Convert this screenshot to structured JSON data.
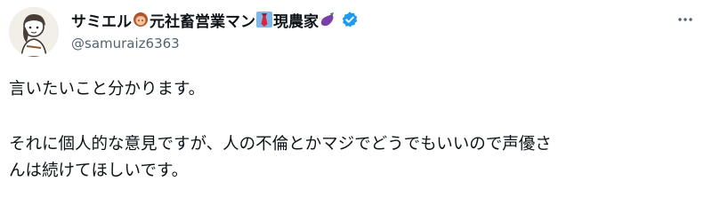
{
  "tweet": {
    "author": {
      "name_parts": [
        "サミエル",
        "元社畜営業マン",
        "現農家"
      ],
      "emojis": [
        "woman-face-icon",
        "necktie-icon",
        "eggplant-icon"
      ],
      "verified": true,
      "handle": "@samuraiz6363"
    },
    "text_lines": [
      "言いたいこと分かります。",
      "それに個人的な意見ですが、人の不倫とかマジでどうでもいいので声優さ",
      "んは続けてほしいです。"
    ],
    "colors": {
      "verified": "#1d9bf0",
      "text": "#0f1419",
      "secondary": "#536471"
    }
  }
}
